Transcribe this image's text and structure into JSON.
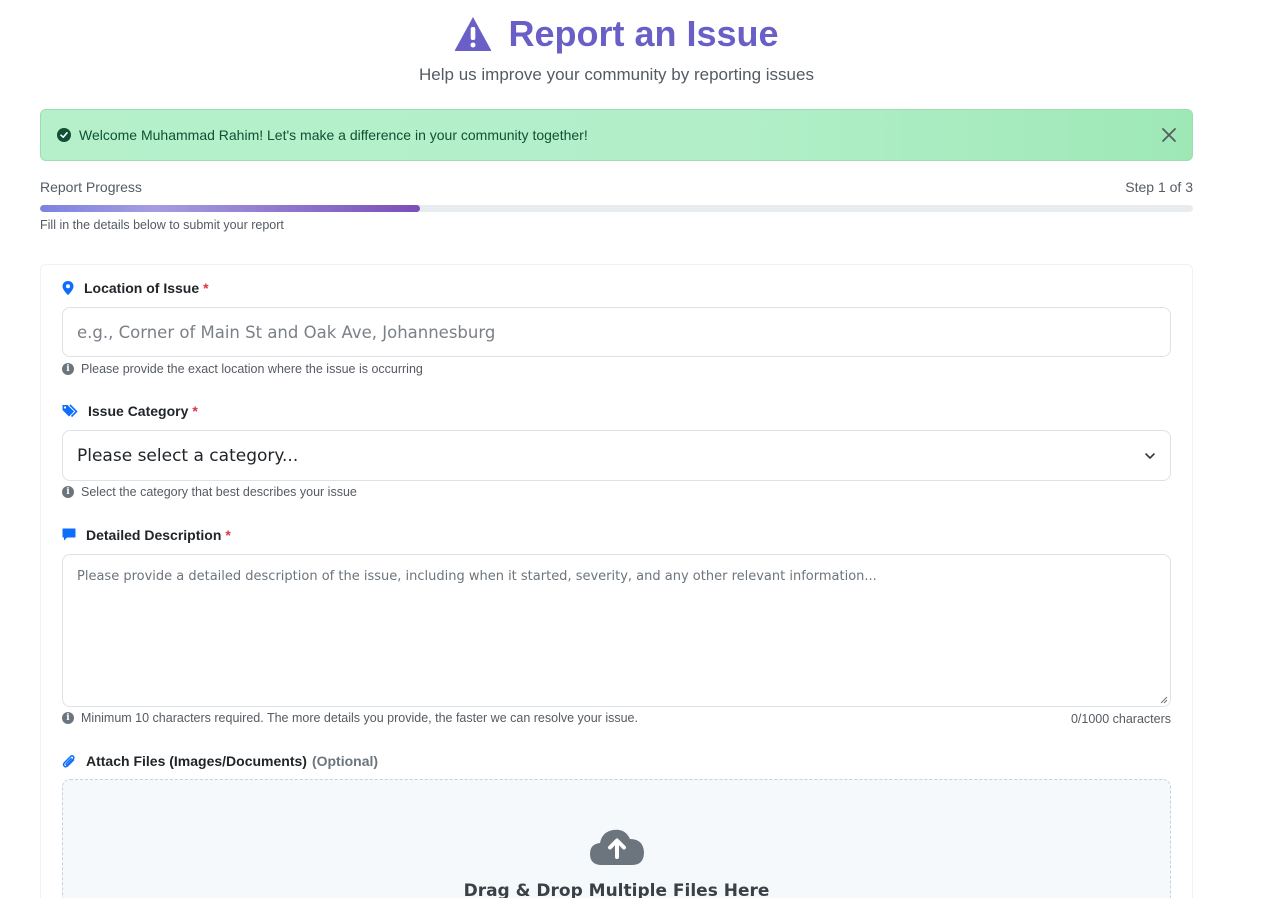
{
  "header": {
    "title": "Report an Issue",
    "subtitle": "Help us improve your community by reporting issues"
  },
  "alert": {
    "message": "Welcome Muhammad Rahim! Let's make a difference in your community together!"
  },
  "progress": {
    "label": "Report Progress",
    "step": "Step 1 of 3",
    "fraction": 0.33,
    "hint": "Fill in the details below to submit your report"
  },
  "form": {
    "location": {
      "label": "Location of Issue",
      "required": "*",
      "placeholder": "e.g., Corner of Main St and Oak Ave, Johannesburg",
      "help": "Please provide the exact location where the issue is occurring"
    },
    "category": {
      "label": "Issue Category",
      "required": "*",
      "selected": "Please select a category...",
      "help": "Select the category that best describes your issue"
    },
    "description": {
      "label": "Detailed Description",
      "required": "*",
      "placeholder": "Please provide a detailed description of the issue, including when it started, severity, and any other relevant information...",
      "help": "Minimum 10 characters required. The more details you provide, the faster we can resolve your issue.",
      "counter": "0/1000 characters"
    },
    "attachments": {
      "label": "Attach Files (Images/Documents)",
      "optional": "(Optional)",
      "drop_title": "Drag & Drop Multiple Files Here"
    }
  },
  "colors": {
    "accent": "#6a5fc7",
    "success_bg": "#b5f0cb",
    "required": "#dc3545",
    "icon_blue": "#0d6efd"
  },
  "icons": {
    "title": "warning-triangle-icon",
    "alert": "check-circle-icon",
    "close": "close-icon",
    "location": "map-pin-icon",
    "category": "tags-icon",
    "description": "comment-icon",
    "attachments": "paperclip-icon",
    "upload": "cloud-upload-icon",
    "info": "info-circle-icon",
    "dropdown": "chevron-down-icon"
  }
}
